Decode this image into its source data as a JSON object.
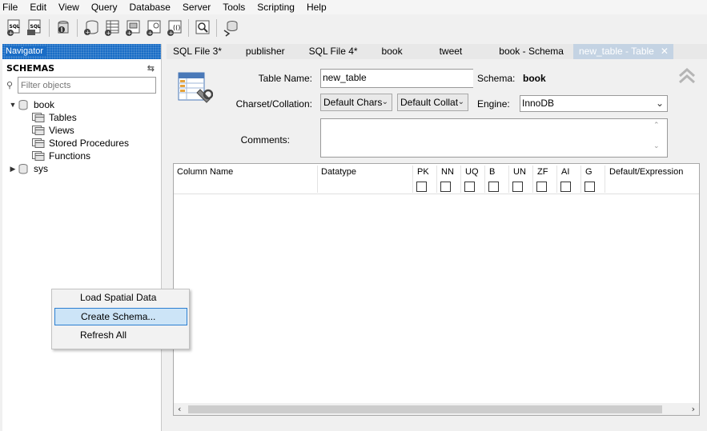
{
  "menu": [
    "File",
    "Edit",
    "View",
    "Query",
    "Database",
    "Server",
    "Tools",
    "Scripting",
    "Help"
  ],
  "toolbar": {
    "icons": [
      "new-sql-tab-icon",
      "open-sql-file-icon",
      "inspector-icon",
      "create-schema-icon",
      "create-table-icon",
      "create-view-icon",
      "create-procedure-icon",
      "create-function-icon",
      "search-table-data-icon",
      "reconnect-icon"
    ]
  },
  "navigator": {
    "title": "Navigator",
    "schemas_label": "SCHEMAS",
    "filter_placeholder": "Filter objects",
    "tree": [
      {
        "name": "book",
        "expanded": true,
        "children": [
          "Tables",
          "Views",
          "Stored Procedures",
          "Functions"
        ]
      },
      {
        "name": "sys",
        "expanded": false,
        "children": []
      }
    ]
  },
  "tabs": [
    {
      "label": "SQL File 3*",
      "active": false
    },
    {
      "label": "publisher",
      "active": false
    },
    {
      "label": "SQL File 4*",
      "active": false
    },
    {
      "label": "book",
      "active": false
    },
    {
      "label": "tweet",
      "active": false
    },
    {
      "label": "book - Schema",
      "active": false
    },
    {
      "label": "new_table - Table",
      "active": true
    }
  ],
  "editor": {
    "table_name_label": "Table Name:",
    "table_name_value": "new_table",
    "schema_label": "Schema:",
    "schema_value": "book",
    "charset_label": "Charset/Collation:",
    "charset_value": "Default Chars",
    "collation_value": "Default Collat",
    "engine_label": "Engine:",
    "engine_value": "InnoDB",
    "comments_label": "Comments:",
    "comments_value": ""
  },
  "grid": {
    "columns": [
      "Column Name",
      "Datatype",
      "PK",
      "NN",
      "UQ",
      "B",
      "UN",
      "ZF",
      "AI",
      "G",
      "Default/Expression"
    ]
  },
  "context_menu": {
    "items": [
      {
        "label": "Load Spatial Data",
        "highlighted": false
      },
      {
        "label": "Create Schema...",
        "highlighted": true
      },
      {
        "label": "Refresh All",
        "highlighted": false
      }
    ]
  },
  "colors": {
    "navigator_header": "#1a6dc6",
    "active_tab": "#c4d3e3",
    "menu_highlight": "#cce4f7",
    "menu_highlight_border": "#2b7fd1"
  }
}
